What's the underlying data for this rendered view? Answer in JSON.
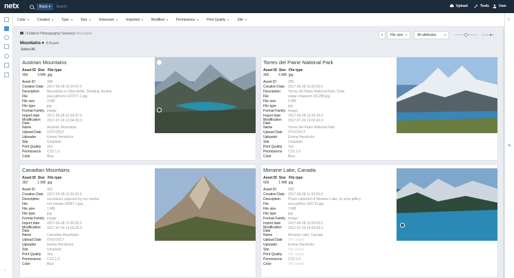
{
  "topbar": {
    "logo": "netx",
    "search_scope": "Basic",
    "search_placeholder": "Search",
    "actions": [
      {
        "label": "Upload",
        "icon": "cloud-upload-icon"
      },
      {
        "label": "Tools",
        "icon": "wrench-icon"
      },
      {
        "label": "User",
        "icon": "user-icon"
      }
    ]
  },
  "filters": [
    "Color",
    "Created",
    "Type",
    "Size",
    "Extension",
    "Imported",
    "Modified",
    "Permissions",
    "Print Quality",
    "Site"
  ],
  "breadcrumb": {
    "home_icon": "home-icon",
    "path": "/ Folders/ Photography/ Scenery/",
    "current": "Mountains"
  },
  "toolbar": {
    "sort": "File size",
    "attributes": "All attributes"
  },
  "collection": {
    "title": "Mountains",
    "count": "8 Assets",
    "select_all": "Select All"
  },
  "summary_headers": [
    "Asset ID",
    "Size",
    "File type"
  ],
  "meta_labels": [
    "Asset ID",
    "Creation Date",
    "Description",
    "File",
    "File size",
    "File type",
    "Format Family",
    "Import date",
    "Modification Date",
    "Name",
    "Upload Date",
    "Uploader",
    "Site",
    "Print Quality",
    "Permissions",
    "Color"
  ],
  "cards": [
    {
      "title": "Austrian Mountains",
      "summary": [
        "369",
        "3 MB",
        "jpg"
      ],
      "values": [
        "369",
        "2017-06-28 11:04:37.0",
        "Mountains in Obernhöfle, Stmding, Austria",
        "paul-gilmore-107277-1.jpg",
        "3 MB",
        "jpg",
        "image",
        "2017-06-28 11:04:37.0",
        "2017-07-24 13:04:20.0",
        "Austrian Mountains",
        "07/07/2017",
        "Emma Hendricks",
        "Unsplash",
        "Yes",
        "CC0 1.0",
        "Blue"
      ]
    },
    {
      "title": "Torres del Paine National Park",
      "summary": [
        "365",
        "5 MB",
        "jpg"
      ],
      "values": [
        "365",
        "2017-06-28 11:00:29.0",
        "Torres del Paine National Park, Chile",
        "edgar-chaparro-101289.jpg",
        "5 MB",
        "jpg",
        "image",
        "2017-06-28 11:00:29.0",
        "2017-07-24 13:02:42.0",
        "Torres del Paine National Park",
        "07/07/2017",
        "Emma Hendricks",
        "Unsplash",
        "Yes",
        "CC0 1.0",
        "Blue"
      ]
    },
    {
      "title": "Canadian Mountains",
      "summary": [
        "362",
        "1 MB",
        "jpg"
      ],
      "values": [
        "362",
        "2017-06-28 11:09:25.0",
        "mountains captured by ron manke",
        "ron-manke-20687-1.jpg",
        "1 MB",
        "jpg",
        "image",
        "2017-06-28 11:06:25.0",
        "2017-07-24 14:03:35.0",
        "Canadian Mountains",
        "07/07/2017",
        "Emma Hendricks",
        "Unsplash",
        "Yes",
        "CC0 1.0",
        "Blue"
      ]
    },
    {
      "title": "Moraine Lake, Canada",
      "summary": [
        "558",
        "1 MB",
        "jpg"
      ],
      "values": [
        "558",
        "2017-06-28 11:09:03.0",
        "Photo captured of Moraine Lake, by ezra jeffery",
        "ezra-jeffery-100710.jpg",
        "1 MB",
        "jpg",
        "image",
        "2017-06-28 11:09:03.0",
        "2017-07-24 14:54:33.0",
        "Moraine Lake, Canada",
        "(No value)",
        "Emma Hendricks",
        "(No value)",
        "(No value)",
        "CC0 1.0",
        "(No value)"
      ]
    }
  ]
}
